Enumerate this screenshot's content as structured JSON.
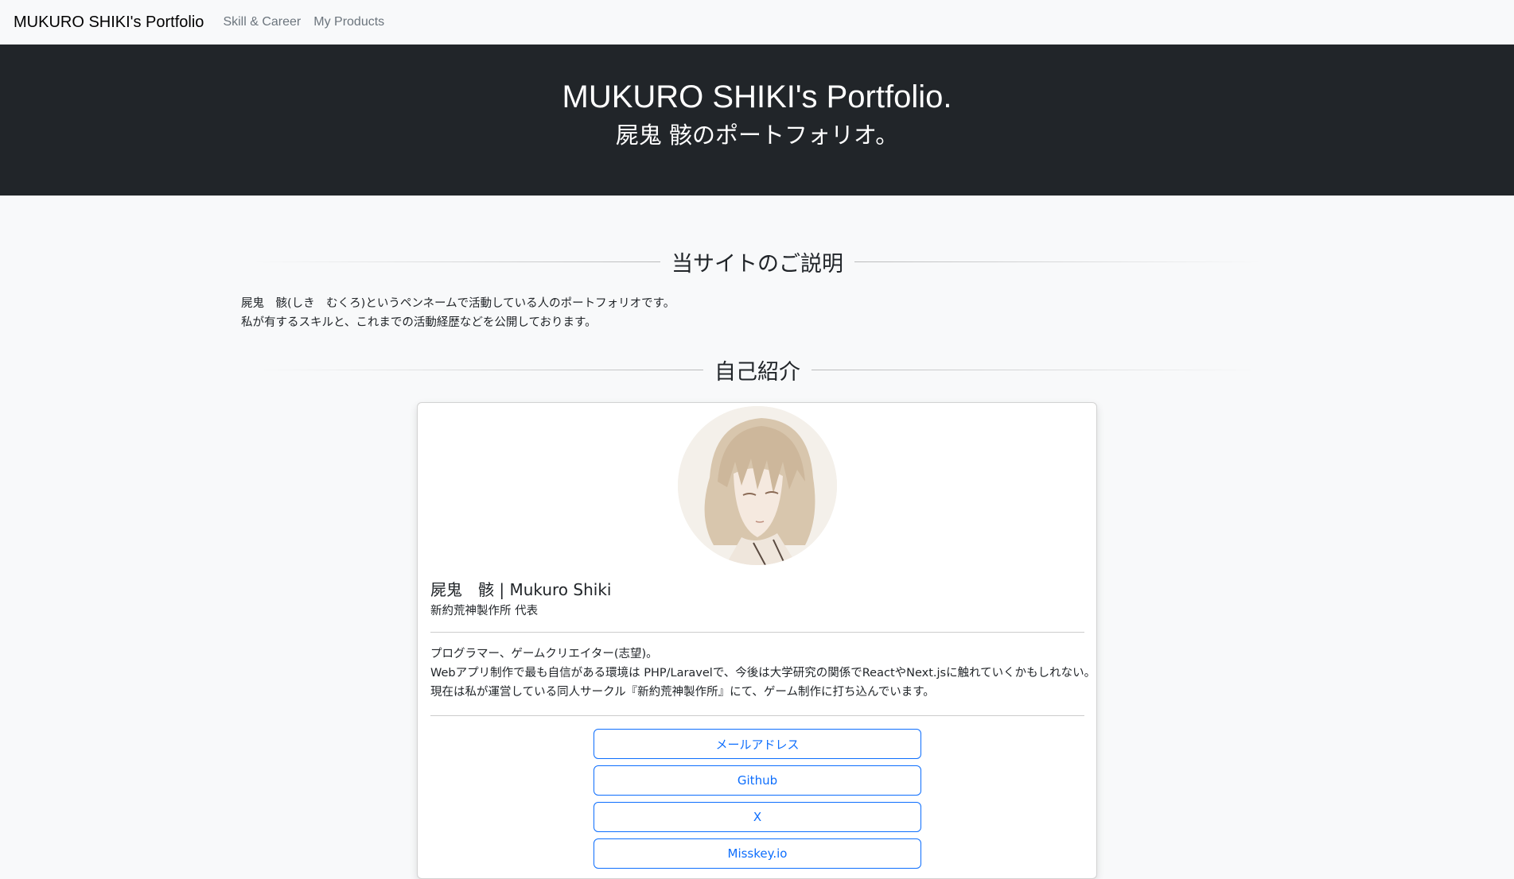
{
  "navbar": {
    "brand": "MUKURO SHIKI's Portfolio",
    "links": [
      "Skill & Career",
      "My Products"
    ]
  },
  "hero": {
    "title": "MUKURO SHIKI's Portfolio.",
    "subtitle": "屍鬼 骸のポートフォリオ。"
  },
  "about": {
    "heading": "当サイトのご説明",
    "lines": [
      "屍鬼　骸(しき　むくろ)というペンネームで活動している人のポートフォリオです。",
      "私が有するスキルと、これまでの活動経歴などを公開しております。"
    ]
  },
  "intro": {
    "heading": "自己紹介"
  },
  "profile": {
    "name": "屍鬼　骸 | Mukuro Shiki",
    "role": "新約荒神製作所 代表",
    "bio": [
      "プログラマー、ゲームクリエイター(志望)。",
      "Webアプリ制作で最も自信がある環境は PHP/Laravelで、今後は大学研究の関係でReactやNext.jsに触れていくかもしれない。",
      "現在は私が運営している同人サークル『新約荒神製作所』にて、ゲーム制作に打ち込んでいます。"
    ],
    "links": [
      "メールアドレス",
      "Github",
      "X",
      "Misskey.io"
    ]
  },
  "colors": {
    "hero_bg": "#212529",
    "page_bg": "#f8f9fa",
    "accent": "#0d6efd"
  }
}
